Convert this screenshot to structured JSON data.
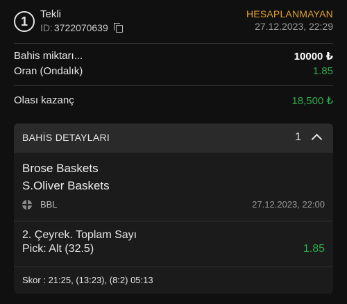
{
  "bet": {
    "index": "1",
    "type": "Tekli",
    "id_label": "ID:",
    "id_value": "3722070639",
    "status": "HESAPLANMAYAN",
    "datetime": "27.12.2023, 22:29"
  },
  "summary": {
    "stake_label": "Bahis miktarı...",
    "stake_value": "10000 ₺",
    "odds_label": "Oran (Ondalık)",
    "odds_value": "1.85",
    "win_label": "Olası kazanç",
    "win_value": "18,500 ₺"
  },
  "details": {
    "title": "BAHİS DETAYLARI",
    "count": "1",
    "home_team": "Brose Baskets",
    "away_team": "S.Oliver Baskets",
    "league": "BBL",
    "match_datetime": "27.12.2023, 22:00",
    "market": "2. Çeyrek. Toplam Sayı",
    "pick_label": "Pick:",
    "pick_value": "Alt (32.5)",
    "pick_odds": "1.85",
    "score": "Skor : 21:25, (13:23), (8:2) 05:13"
  },
  "colors": {
    "status": "#e0a030",
    "positive": "#2eaa4c",
    "background": "#101010",
    "panel": "#1b1b1b"
  },
  "icons": [
    "number-circle-icon",
    "copy-icon",
    "chevron-up-icon",
    "basketball-icon"
  ]
}
